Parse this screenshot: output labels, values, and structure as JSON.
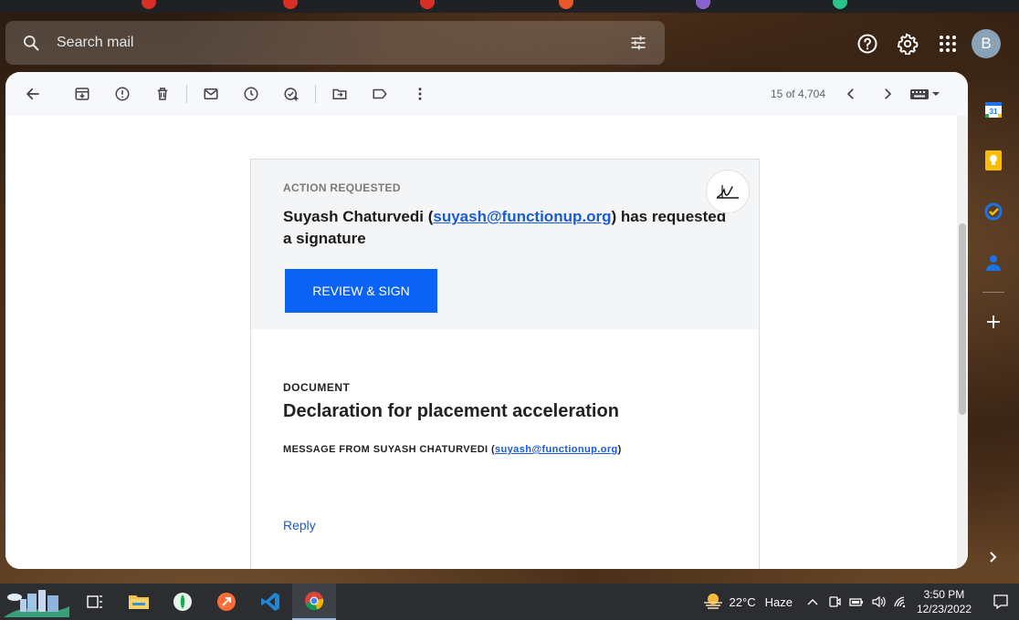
{
  "search": {
    "placeholder": "Search mail"
  },
  "header": {
    "avatar_letter": "B"
  },
  "toolbar": {
    "pager": "15 of 4,704"
  },
  "email": {
    "action_label": "ACTION REQUESTED",
    "requester_name": "Suyash Chaturvedi (",
    "requester_email": "suyash@functionup.org",
    "requester_suffix": ") has requested a signature",
    "review_button": "REVIEW & SIGN",
    "document_label": "DOCUMENT",
    "document_title": "Declaration for placement acceleration",
    "message_from_prefix": "MESSAGE FROM SUYASH CHATURVEDI (",
    "message_from_email": "suyash@functionup.org",
    "message_from_suffix": ")",
    "reply_label": "Reply"
  },
  "taskbar": {
    "weather_temp": "22°C",
    "weather_desc": "Haze",
    "time": "3:50 PM",
    "date": "12/23/2022"
  },
  "colors": {
    "primary_button": "#0b63f6",
    "link": "#1a5bd6",
    "taskbar": "#2b2d30"
  }
}
